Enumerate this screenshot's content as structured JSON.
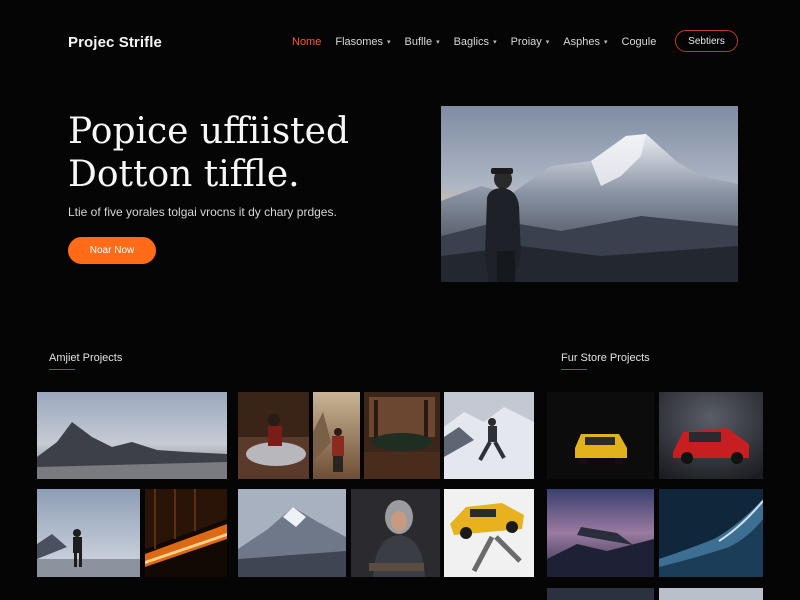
{
  "brand": "Projec Strifle",
  "nav": {
    "items": [
      {
        "label": "Nome",
        "active": true,
        "dropdown": false
      },
      {
        "label": "Flasomes",
        "active": false,
        "dropdown": true
      },
      {
        "label": "Buflle",
        "active": false,
        "dropdown": true
      },
      {
        "label": "Baglics",
        "active": false,
        "dropdown": true
      },
      {
        "label": "Proiay",
        "active": false,
        "dropdown": true
      },
      {
        "label": "Asphes",
        "active": false,
        "dropdown": true
      },
      {
        "label": "Cogule",
        "active": false,
        "dropdown": false
      }
    ],
    "button_label": "Sebtiers"
  },
  "hero": {
    "title_line1": "Popice uffiisted",
    "title_line2": "Dotton tiffle.",
    "subtitle": "Ltie of five yorales tolgai vrocns it dy chary prdges.",
    "cta_label": "Noar Now"
  },
  "sections": {
    "left_title": "Amjiet Projects",
    "right_title": "Fur Store Projects"
  },
  "colors": {
    "background": "#050505",
    "accent": "#ff6b16",
    "active_nav": "#ff5a2e",
    "underline": "#c0392b"
  }
}
